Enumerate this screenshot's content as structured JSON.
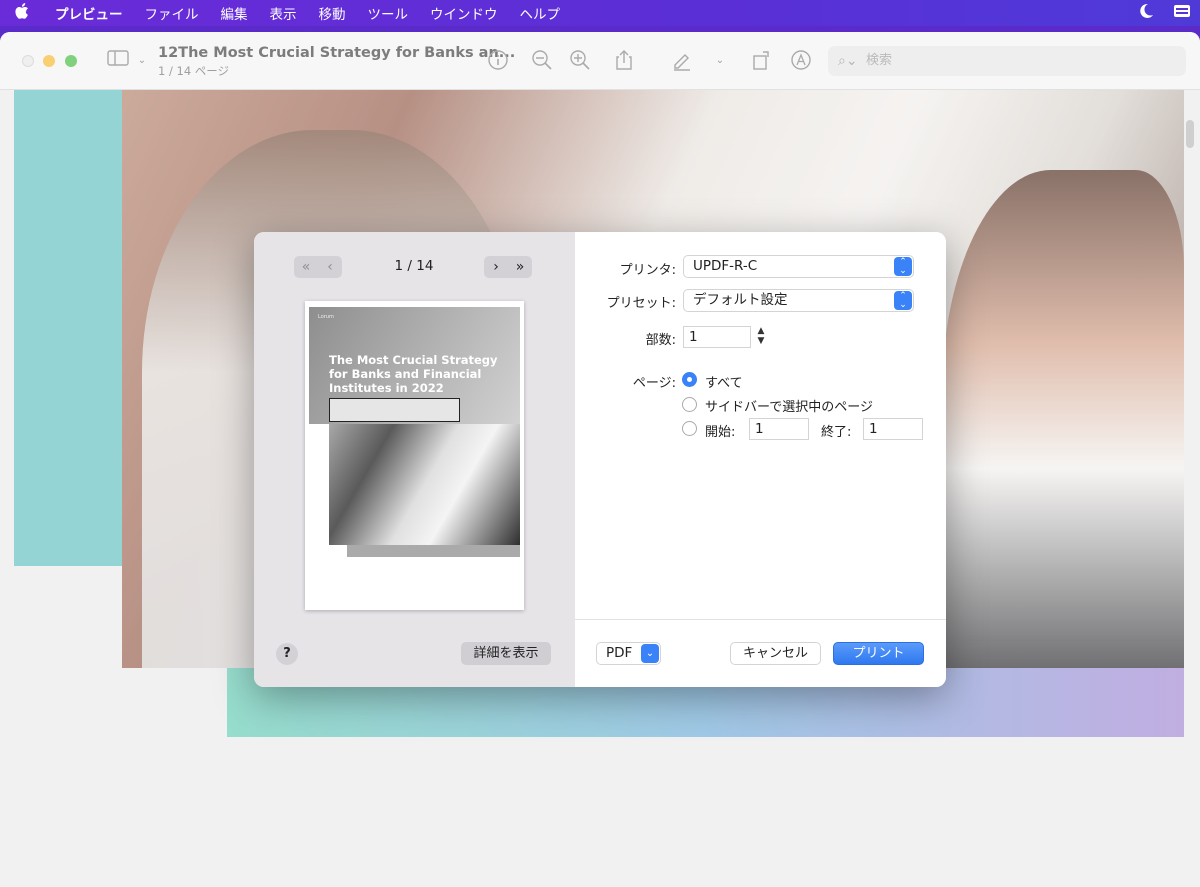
{
  "menubar": {
    "apple": "",
    "items": [
      "プレビュー",
      "ファイル",
      "編集",
      "表示",
      "移動",
      "ツール",
      "ウインドウ",
      "ヘルプ"
    ]
  },
  "toolbar": {
    "title": "12The Most Crucial Strategy for Banks an...",
    "subtitle": "1 / 14 ページ",
    "search_placeholder": "検索"
  },
  "print_dialog": {
    "page_indicator": "1 / 14",
    "thumbnail": {
      "title": "The Most Crucial Strategy for Banks and Financial Institutes in 2022",
      "logo": "Lorum"
    },
    "details_button": "詳細を表示",
    "help_button": "?",
    "printer_label": "プリンタ:",
    "printer_value": "UPDF-R-C",
    "preset_label": "プリセット:",
    "preset_value": "デフォルト設定",
    "copies_label": "部数:",
    "copies_value": "1",
    "pages_label": "ページ:",
    "pages_options": {
      "all": "すべて",
      "selection": "サイドバーで選択中のページ",
      "from": "開始:",
      "to": "終了:"
    },
    "from_value": "1",
    "to_value": "1",
    "selected_pages_option": "all",
    "pdf_button": "PDF",
    "cancel_button": "キャンセル",
    "print_button": "プリント"
  },
  "colors": {
    "menubar": "#6a2bd8",
    "accent": "#3a82f7",
    "teal": "#6cc4c4"
  }
}
